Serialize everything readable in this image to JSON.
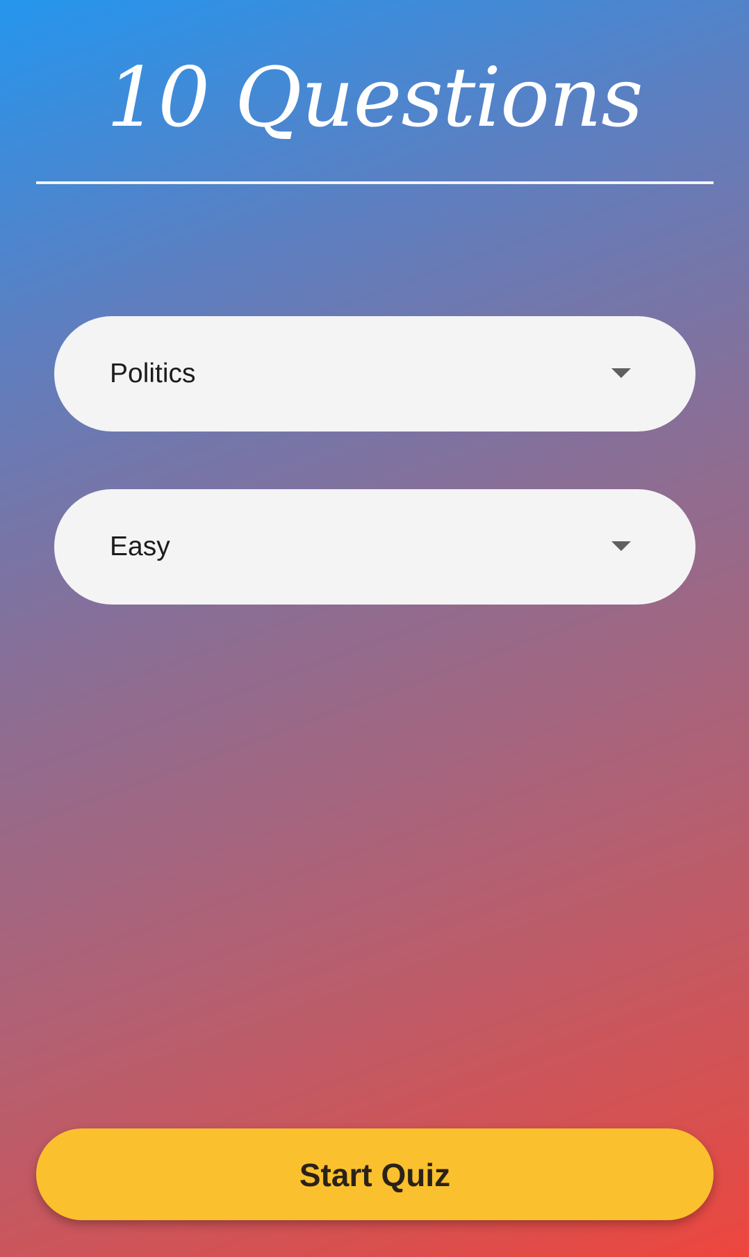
{
  "header": {
    "title": "10 Questions"
  },
  "form": {
    "category": {
      "selected": "Politics",
      "icon": "dropdown-arrow-icon"
    },
    "difficulty": {
      "selected": "Easy",
      "icon": "dropdown-arrow-icon"
    }
  },
  "actions": {
    "start_label": "Start Quiz"
  },
  "colors": {
    "gradient_start": "#2596ee",
    "gradient_end": "#ee463e",
    "button": "#fbc02d",
    "field": "#f4f4f5"
  }
}
